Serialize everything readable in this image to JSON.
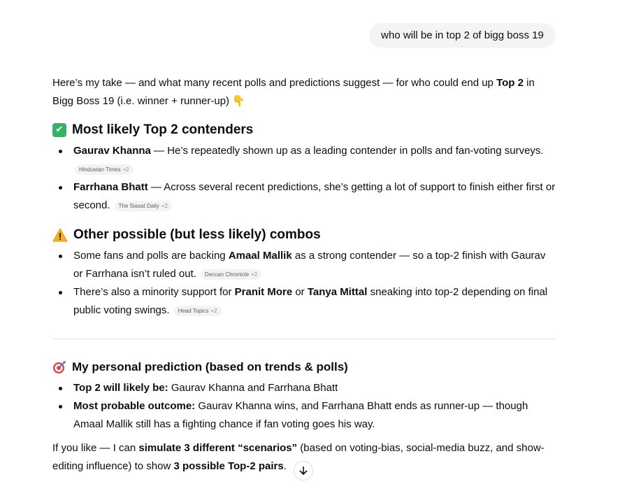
{
  "user_message": "who will be in top 2 of bigg boss 19",
  "intro": {
    "part1": "Here’s my take — and what many recent polls and predictions suggest — for who could end up ",
    "bold1": "Top 2",
    "part2": " in",
    "line2": "Bigg Boss 19 (i.e. winner + runner-up) ",
    "emoji": "👇"
  },
  "section1": {
    "heading": "Most likely Top 2 contenders",
    "icon": "check-icon",
    "items": [
      {
        "bold": "Gaurav Khanna",
        "text": " — He’s repeatedly shown up as a leading contender in polls and fan-voting surveys.",
        "chip": "Hindustan Times",
        "chip_more": "+2"
      },
      {
        "bold": "Farrhana Bhatt",
        "text": " — Across several recent predictions, she’s getting a lot of support to finish either first or second.",
        "chip": "The Siasat Daily",
        "chip_more": "+2"
      }
    ]
  },
  "section2": {
    "heading": "Other possible (but less likely) combos",
    "icon": "warning-icon",
    "items": [
      {
        "pre": "Some fans and polls are backing ",
        "bold": "Amaal Mallik",
        "text": " as a strong contender — so a top-2 finish with Gaurav or Farrhana isn’t ruled out.",
        "chip": "Deccan Chronicle",
        "chip_more": "+2"
      },
      {
        "pre": "There’s also a minority support for ",
        "bold": "Pranit More",
        "mid": " or ",
        "bold2": "Tanya Mittal",
        "text": " sneaking into top-2 depending on final public voting swings.",
        "chip": "Head Topics",
        "chip_more": "+2"
      }
    ]
  },
  "section3": {
    "heading": "My personal prediction (based on trends & polls)",
    "icon": "target-icon",
    "items": [
      {
        "bold": "Top 2 will likely be:",
        "text": " Gaurav Khanna and Farrhana Bhatt"
      },
      {
        "bold": "Most probable outcome:",
        "text": " Gaurav Khanna wins, and Farrhana Bhatt ends as runner-up — though Amaal Mallik still has a fighting chance if fan voting goes his way."
      }
    ]
  },
  "outro": {
    "part1": "If you like — I can ",
    "bold1": "simulate 3 different “scenarios”",
    "part2": " (based on voting-bias, social-media buzz, and show-editing influence) to show ",
    "bold2": "3 possible Top-2 pairs",
    "part3": "."
  }
}
